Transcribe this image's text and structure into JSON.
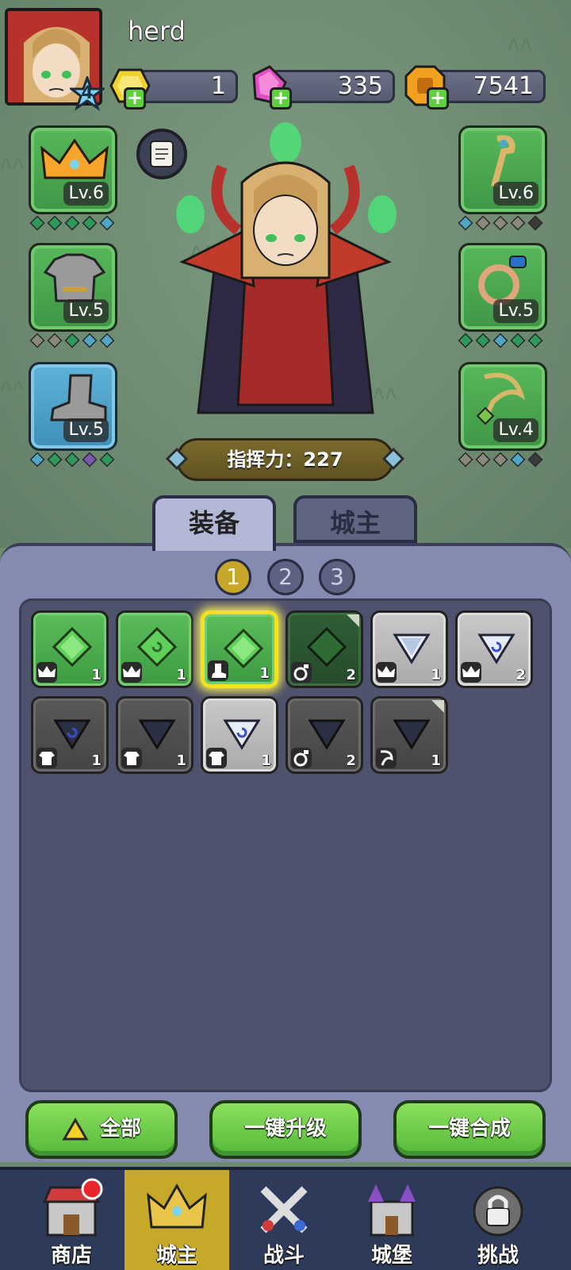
{
  "player": {
    "name": "herd",
    "level": "4"
  },
  "resources": [
    {
      "name": "gold-gem",
      "value": "1",
      "color": "#f2d32b"
    },
    {
      "name": "pink-gem",
      "value": "335",
      "color": "#e04fc4"
    },
    {
      "name": "coin",
      "value": "7541",
      "color": "#f0a21e"
    }
  ],
  "equipment": {
    "left": [
      {
        "name": "crown",
        "level": "Lv.6",
        "gems": [
          "#2d9a5a",
          "#2d9a5a",
          "#2d9a5a",
          "#2d9a5a",
          "#4fa6c7"
        ]
      },
      {
        "name": "armor",
        "level": "Lv.5",
        "gems": [
          "#8a8a7a",
          "#8a8a7a",
          "#2d9a5a",
          "#4fa6c7",
          "#4fa6c7"
        ]
      },
      {
        "name": "boots",
        "level": "Lv.5",
        "gems": [
          "#4fa6c7",
          "#2d9a5a",
          "#2d9a5a",
          "#7a58b0",
          "#2d9a5a"
        ]
      }
    ],
    "right": [
      {
        "name": "staff",
        "level": "Lv.6",
        "gems": [
          "#4fa6c7",
          "#8a8a7a",
          "#8a8a7a",
          "#8a8a7a",
          "#3a3a3a"
        ]
      },
      {
        "name": "ring",
        "level": "Lv.5",
        "gems": [
          "#2d9a5a",
          "#2d9a5a",
          "#4fa6c7",
          "#2d9a5a",
          "#2d9a5a"
        ]
      },
      {
        "name": "necklace",
        "level": "Lv.4",
        "gems": [
          "#8a8a7a",
          "#8a8a7a",
          "#8a8a7a",
          "#4fa6c7",
          "#3a3a3a"
        ]
      }
    ]
  },
  "command_power": "指挥力：227",
  "tabs": {
    "equipment": "装备",
    "lord": "城主"
  },
  "pages": [
    "1",
    "2",
    "3"
  ],
  "active_page": "1",
  "inventory": [
    {
      "style": "green",
      "gem": "green",
      "cat": "crown",
      "count": "1",
      "corner": false,
      "selected": false
    },
    {
      "style": "green",
      "gem": "green-spiral",
      "cat": "crown",
      "count": "1",
      "corner": false,
      "selected": false
    },
    {
      "style": "green",
      "gem": "green",
      "cat": "boots",
      "count": "1",
      "corner": false,
      "selected": true
    },
    {
      "style": "dkgreen",
      "gem": "dkgreen",
      "cat": "ring",
      "count": "2",
      "corner": true,
      "selected": false
    },
    {
      "style": "grey",
      "gem": "white-tri",
      "cat": "crown",
      "count": "1",
      "corner": false,
      "selected": false
    },
    {
      "style": "grey",
      "gem": "white-tri-spiral",
      "cat": "crown",
      "count": "2",
      "corner": false,
      "selected": false
    },
    {
      "style": "dark",
      "gem": "dark-tri-spiral",
      "cat": "armor",
      "count": "1",
      "corner": false,
      "selected": false
    },
    {
      "style": "dark",
      "gem": "dark-tri",
      "cat": "armor",
      "count": "1",
      "corner": false,
      "selected": false
    },
    {
      "style": "grey",
      "gem": "white-tri-spiral",
      "cat": "armor",
      "count": "1",
      "corner": false,
      "selected": false
    },
    {
      "style": "dark",
      "gem": "dark-tri",
      "cat": "ring",
      "count": "2",
      "corner": false,
      "selected": false
    },
    {
      "style": "dark",
      "gem": "dark-tri",
      "cat": "necklace",
      "count": "1",
      "corner": true,
      "selected": false
    }
  ],
  "actions": {
    "all": "全部",
    "upgrade_all": "一键升级",
    "merge_all": "一键合成"
  },
  "nav": [
    {
      "id": "shop",
      "label": "商店",
      "icon": "shop-icon"
    },
    {
      "id": "lord",
      "label": "城主",
      "icon": "crown-icon",
      "active": true
    },
    {
      "id": "battle",
      "label": "战斗",
      "icon": "swords-icon"
    },
    {
      "id": "castle",
      "label": "城堡",
      "icon": "castle-icon"
    },
    {
      "id": "challenge",
      "label": "挑战",
      "icon": "lock-icon"
    }
  ]
}
